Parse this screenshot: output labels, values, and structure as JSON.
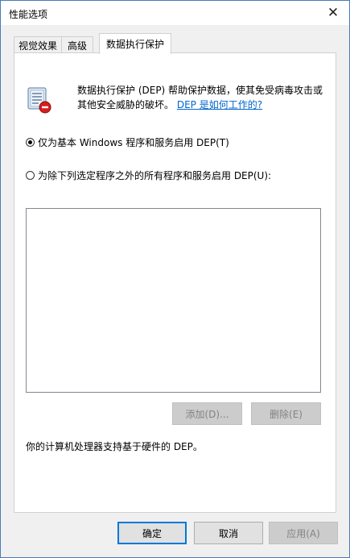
{
  "window": {
    "title": "性能选项",
    "close_symbol": "✕"
  },
  "tabs": [
    {
      "label": "视觉效果"
    },
    {
      "label": "高级"
    },
    {
      "label": "数据执行保护"
    }
  ],
  "dep": {
    "icon": "dep-shield-icon",
    "description": "数据执行保护 (DEP) 帮助保护数据，使其免受病毒攻击或其他安全威胁的破坏。",
    "help_link": "DEP 是如何工作的?",
    "radio_essential": "仅为基本 Windows 程序和服务启用 DEP(T)",
    "radio_all_except": "为除下列选定程序之外的所有程序和服务启用 DEP(U):",
    "selected_option": "essential",
    "add_button": "添加(D)...",
    "remove_button": "删除(E)",
    "support_text": "你的计算机处理器支持基于硬件的 DEP。"
  },
  "footer": {
    "ok": "确定",
    "cancel": "取消",
    "apply": "应用(A)"
  },
  "colors": {
    "link": "#0066cc",
    "window_border": "#4a7ab8",
    "focus_border": "#0078d7"
  }
}
